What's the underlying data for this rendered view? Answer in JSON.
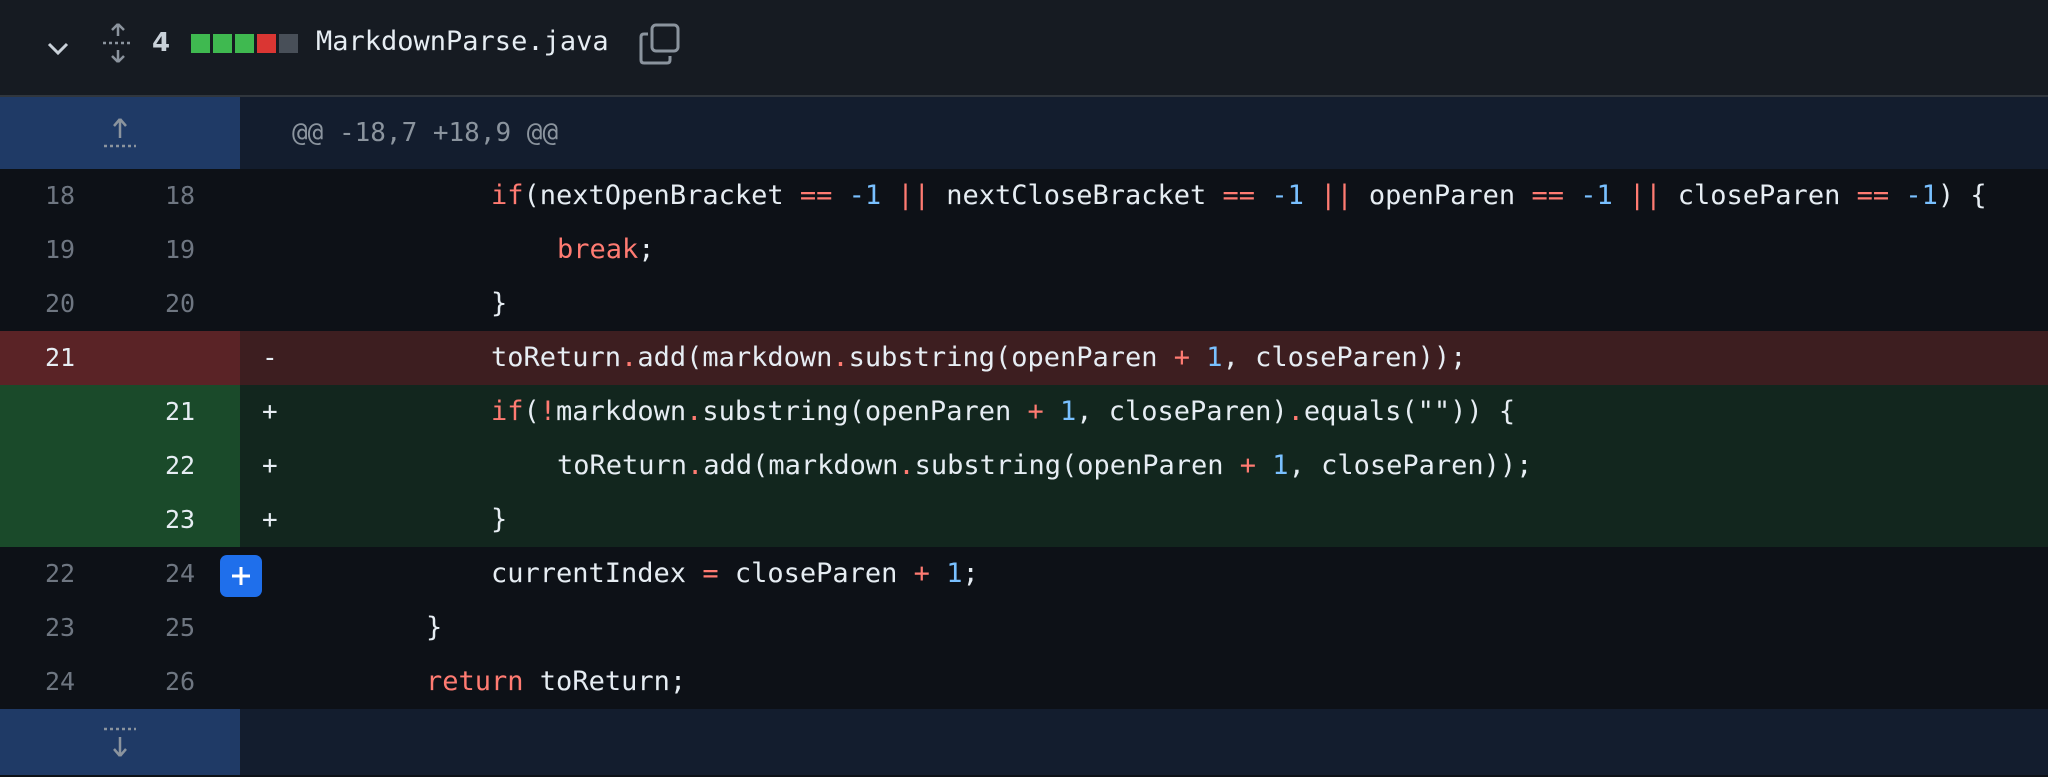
{
  "file": {
    "changes": "4",
    "name": "MarkdownParse.java",
    "diffstat": [
      "#3fb950",
      "#3fb950",
      "#3fb950",
      "#da3633",
      "#484f58"
    ]
  },
  "hunk": {
    "header": "@@ -18,7 +18,9 @@"
  },
  "lines": [
    {
      "type": "ctx",
      "old": "18",
      "new": "18",
      "marker": ""
    },
    {
      "type": "ctx",
      "old": "19",
      "new": "19",
      "marker": ""
    },
    {
      "type": "ctx",
      "old": "20",
      "new": "20",
      "marker": ""
    },
    {
      "type": "del",
      "old": "21",
      "new": "",
      "marker": "-"
    },
    {
      "type": "add",
      "old": "",
      "new": "21",
      "marker": "+"
    },
    {
      "type": "add",
      "old": "",
      "new": "22",
      "marker": "+"
    },
    {
      "type": "add",
      "old": "",
      "new": "23",
      "marker": "+"
    },
    {
      "type": "ctx",
      "old": "22",
      "new": "24",
      "marker": ""
    },
    {
      "type": "ctx",
      "old": "23",
      "new": "25",
      "marker": ""
    },
    {
      "type": "ctx",
      "old": "24",
      "new": "26",
      "marker": ""
    }
  ],
  "code": {
    "l0": {
      "a": "if",
      "b": "(nextOpenBracket ",
      "c": "==",
      "d": " ",
      "e": "-1",
      "f": " ",
      "g": "||",
      "h": " nextCloseBracket ",
      "i": "==",
      "j": " ",
      "k": "-1",
      "l": " ",
      "m": "||",
      "n": " openParen ",
      "o": "==",
      "p": " ",
      "q": "-1",
      "r": " ",
      "s": "||",
      "t": " closeParen ",
      "u": "==",
      "v": " ",
      "w": "-1",
      "x": ") {"
    },
    "l1": {
      "a": "break",
      "b": ";"
    },
    "l2": {
      "a": "}"
    },
    "l3": {
      "a": "toReturn",
      "b": ".",
      "c": "add(markdown",
      "d": ".",
      "e": "substring(openParen ",
      "f": "+",
      "g": " ",
      "h": "1",
      "i": ", closeParen));"
    },
    "l4": {
      "a": "if",
      "b": "(",
      "c": "!",
      "d": "markdown",
      "e": ".",
      "f": "substring(openParen ",
      "g": "+",
      "h": " ",
      "i": "1",
      "j": ", closeParen)",
      "k": ".",
      "l": "equals(\"\")) {"
    },
    "l5": {
      "a": "toReturn",
      "b": ".",
      "c": "add(markdown",
      "d": ".",
      "e": "substring(openParen ",
      "f": "+",
      "g": " ",
      "h": "1",
      "i": ", closeParen));"
    },
    "l6": {
      "a": "}"
    },
    "l7": {
      "a": "currentIndex ",
      "b": "=",
      "c": " closeParen ",
      "d": "+",
      "e": " ",
      "f": "1",
      "g": ";"
    },
    "l8": {
      "a": "}"
    },
    "l9": {
      "a": "return",
      "b": " toReturn;"
    }
  }
}
